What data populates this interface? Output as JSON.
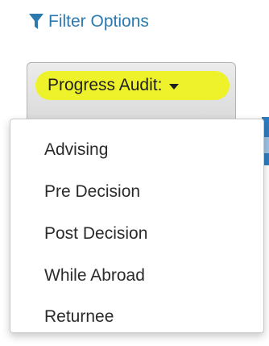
{
  "filter": {
    "label": "Filter Options",
    "icon": "funnel-icon",
    "color": "#2a7ab0"
  },
  "audit_button": {
    "label": "Progress Audit:",
    "icon": "caret-down-icon",
    "highlight_color": "#eef22a"
  },
  "dropdown": {
    "items": [
      {
        "label": "Advising"
      },
      {
        "label": "Pre Decision"
      },
      {
        "label": "Post Decision"
      },
      {
        "label": "While Abroad"
      },
      {
        "label": "Returnee"
      }
    ]
  }
}
